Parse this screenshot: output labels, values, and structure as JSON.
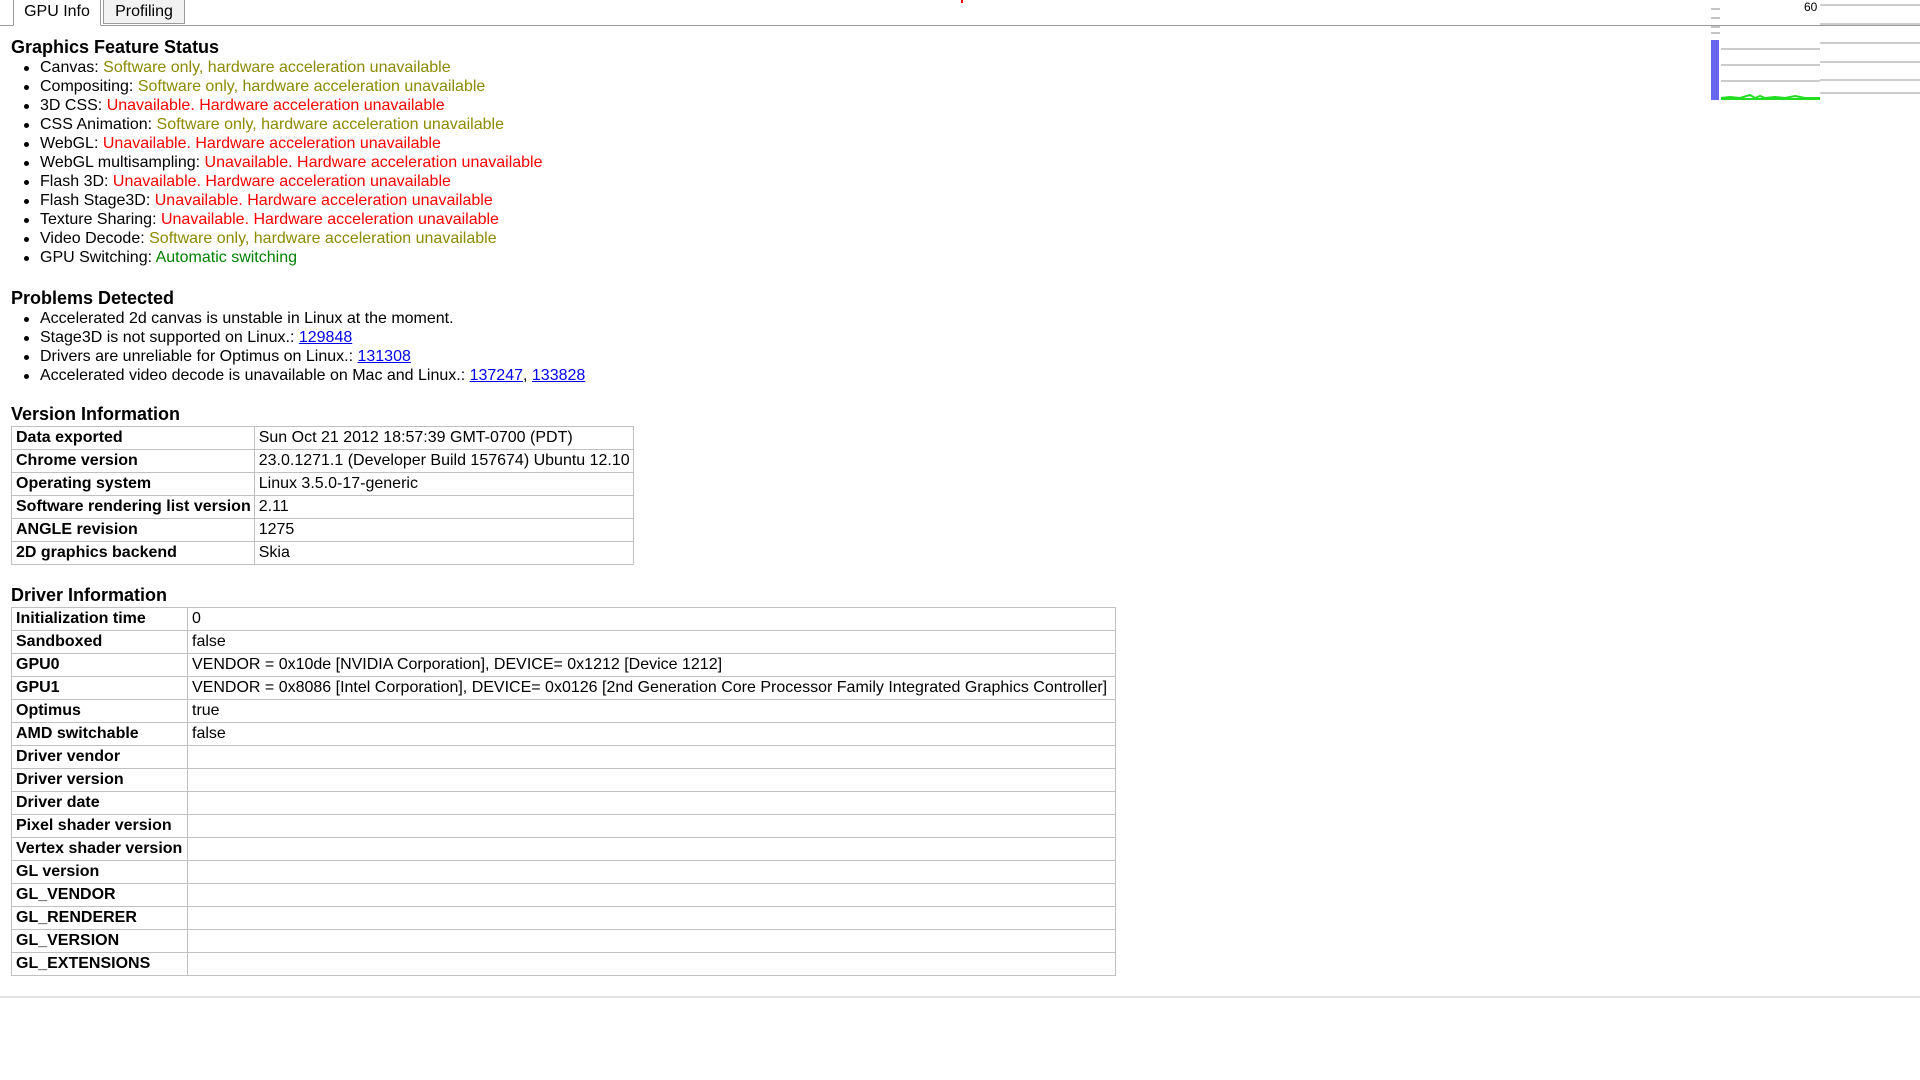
{
  "tabs": [
    {
      "label": "GPU Info",
      "active": true
    },
    {
      "label": "Profiling",
      "active": false
    }
  ],
  "perf_widget": {
    "fps_label": "60"
  },
  "features": {
    "title": "Graphics Feature Status",
    "items": [
      {
        "name": "Canvas:",
        "status": "Software only, hardware acceleration unavailable",
        "kind": "software"
      },
      {
        "name": "Compositing:",
        "status": "Software only, hardware acceleration unavailable",
        "kind": "software"
      },
      {
        "name": "3D CSS:",
        "status": "Unavailable. Hardware acceleration unavailable",
        "kind": "unavailable"
      },
      {
        "name": "CSS Animation:",
        "status": "Software only, hardware acceleration unavailable",
        "kind": "software"
      },
      {
        "name": "WebGL:",
        "status": "Unavailable. Hardware acceleration unavailable",
        "kind": "unavailable"
      },
      {
        "name": "WebGL multisampling:",
        "status": "Unavailable. Hardware acceleration unavailable",
        "kind": "unavailable"
      },
      {
        "name": "Flash 3D:",
        "status": "Unavailable. Hardware acceleration unavailable",
        "kind": "unavailable"
      },
      {
        "name": "Flash Stage3D:",
        "status": "Unavailable. Hardware acceleration unavailable",
        "kind": "unavailable"
      },
      {
        "name": "Texture Sharing:",
        "status": "Unavailable. Hardware acceleration unavailable",
        "kind": "unavailable"
      },
      {
        "name": "Video Decode:",
        "status": "Software only, hardware acceleration unavailable",
        "kind": "software"
      },
      {
        "name": "GPU Switching:",
        "status": "Automatic switching",
        "kind": "enabled"
      }
    ]
  },
  "status_colors": {
    "software": "#8b8b00",
    "unavailable": "#ff0000",
    "enabled": "#008000",
    "link": "#0000ee"
  },
  "problems": {
    "title": "Problems Detected",
    "items": [
      {
        "text": "Accelerated 2d canvas is unstable in Linux at the moment.",
        "links": []
      },
      {
        "text": "Stage3D is not supported on Linux.: ",
        "links": [
          "129848"
        ]
      },
      {
        "text": "Drivers are unreliable for Optimus on Linux.: ",
        "links": [
          "131308"
        ]
      },
      {
        "text": "Accelerated video decode is unavailable on Mac and Linux.: ",
        "links": [
          "137247",
          "133828"
        ]
      }
    ]
  },
  "version": {
    "title": "Version Information",
    "rows": [
      {
        "key": "Data exported",
        "value": "Sun Oct 21 2012 18:57:39 GMT-0700 (PDT)"
      },
      {
        "key": "Chrome version",
        "value": "23.0.1271.1 (Developer Build 157674) Ubuntu 12.10"
      },
      {
        "key": "Operating system",
        "value": "Linux 3.5.0-17-generic"
      },
      {
        "key": "Software rendering list version",
        "value": "2.11"
      },
      {
        "key": "ANGLE revision",
        "value": "1275"
      },
      {
        "key": "2D graphics backend",
        "value": "Skia"
      }
    ]
  },
  "driver": {
    "title": "Driver Information",
    "rows": [
      {
        "key": "Initialization time",
        "value": "0"
      },
      {
        "key": "Sandboxed",
        "value": "false"
      },
      {
        "key": "GPU0",
        "value": "VENDOR = 0x10de [NVIDIA Corporation], DEVICE= 0x1212 [Device 1212]"
      },
      {
        "key": "GPU1",
        "value": "VENDOR = 0x8086 [Intel Corporation], DEVICE= 0x0126 [2nd Generation Core Processor Family Integrated Graphics Controller]"
      },
      {
        "key": "Optimus",
        "value": "true"
      },
      {
        "key": "AMD switchable",
        "value": "false"
      },
      {
        "key": "Driver vendor",
        "value": ""
      },
      {
        "key": "Driver version",
        "value": ""
      },
      {
        "key": "Driver date",
        "value": ""
      },
      {
        "key": "Pixel shader version",
        "value": ""
      },
      {
        "key": "Vertex shader version",
        "value": ""
      },
      {
        "key": "GL version",
        "value": ""
      },
      {
        "key": "GL_VENDOR",
        "value": ""
      },
      {
        "key": "GL_RENDERER",
        "value": ""
      },
      {
        "key": "GL_VERSION",
        "value": ""
      },
      {
        "key": "GL_EXTENSIONS",
        "value": ""
      }
    ]
  }
}
